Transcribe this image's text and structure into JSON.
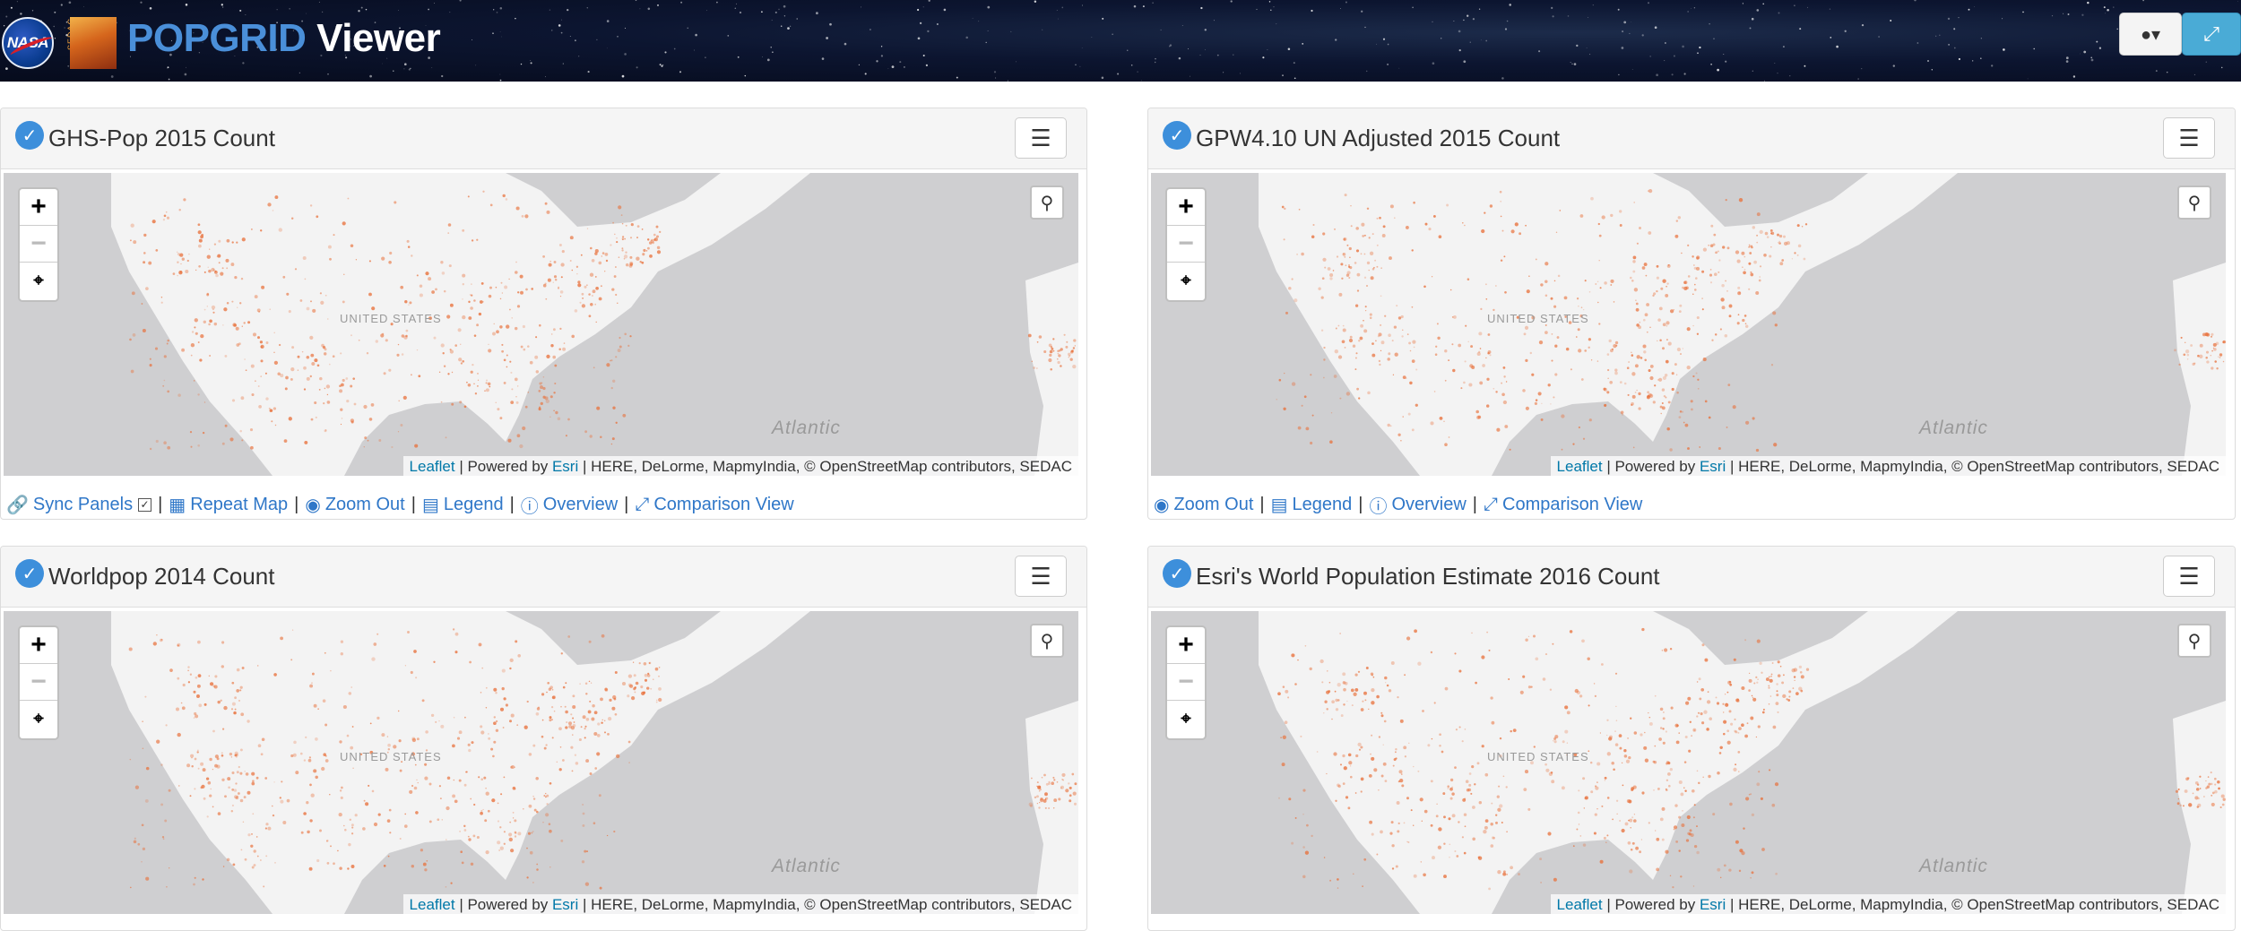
{
  "header": {
    "logo_nasa": "NASA",
    "logo_sedac": "SEDAC",
    "title_highlight": "POPGRID",
    "title_rest": " Viewer",
    "globe_icon": "globe-icon",
    "fullscreen_icon": "fullscreen-icon"
  },
  "attribution": {
    "leaflet": "Leaflet",
    "powered_by": " | Powered by ",
    "esri": "Esri",
    "rest": " | HERE, DeLorme, MapmyIndia, © OpenStreetMap contributors, SEDAC"
  },
  "map_labels": {
    "ocean": "Atlantic",
    "country": "UNITED STATES"
  },
  "zoom": {
    "in": "+",
    "out": "−",
    "extent": "⌖"
  },
  "panels": [
    {
      "title": "GHS-Pop 2015 Count",
      "footer": {
        "sync": "Sync Panels",
        "repeat": "Repeat Map",
        "zoom_out": "Zoom Out",
        "legend": "Legend",
        "overview": "Overview",
        "comparison": "Comparison View"
      }
    },
    {
      "title": "GPW4.10 UN Adjusted 2015 Count",
      "footer": {
        "zoom_out": "Zoom Out",
        "legend": "Legend",
        "overview": "Overview",
        "comparison": "Comparison View"
      }
    },
    {
      "title": "Worldpop 2014 Count"
    },
    {
      "title": "Esri's World Population Estimate 2016 Count"
    }
  ],
  "colors": {
    "accent": "#3d8fdb",
    "title_blue": "#4a8fd9",
    "link": "#2f77c8",
    "map_ocean": "#cfcfd1",
    "map_land": "#f3f3f3",
    "population_dot": "#e8703a"
  }
}
